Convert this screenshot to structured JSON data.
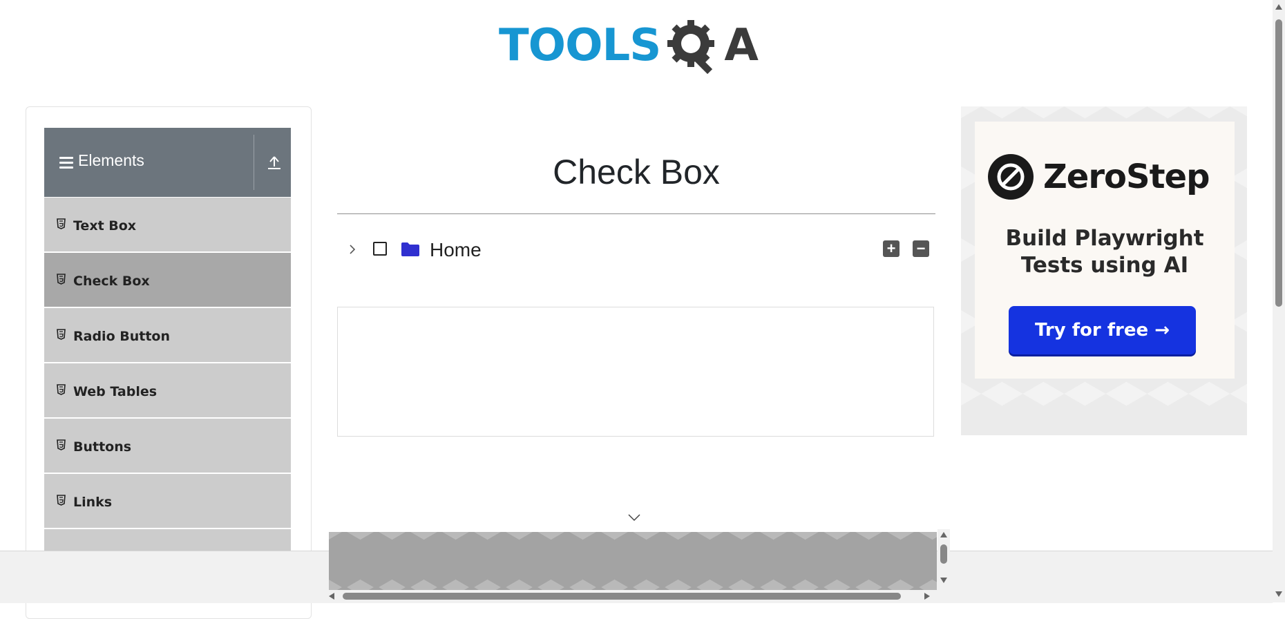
{
  "header": {
    "logo_text": "TOOLS",
    "logo_suffix": "A",
    "logo_alt": "TOOLSQA"
  },
  "sidebar": {
    "group_title": "Elements",
    "items": [
      {
        "label": "Text Box",
        "active": false
      },
      {
        "label": "Check Box",
        "active": true
      },
      {
        "label": "Radio Button",
        "active": false
      },
      {
        "label": "Web Tables",
        "active": false
      },
      {
        "label": "Buttons",
        "active": false
      },
      {
        "label": "Links",
        "active": false
      }
    ]
  },
  "main": {
    "title": "Check Box",
    "tree": {
      "root_label": "Home",
      "expand_all_symbol": "+",
      "collapse_all_symbol": "−"
    }
  },
  "ad": {
    "brand": "ZeroStep",
    "headline_line1": "Build Playwright",
    "headline_line2": "Tests using AI",
    "cta": "Try for free →"
  },
  "colors": {
    "brand_blue": "#1796d2",
    "sidebar_header": "#6c757d",
    "menu_item": "#cccccc",
    "menu_item_active": "#a8a8a8",
    "folder_icon": "#3030d0",
    "cta_blue": "#1533e0"
  },
  "icons": {
    "menu": "hamburger-icon",
    "group_toggle": "upload-arrow-icon",
    "menu_item": "html5-icon",
    "tree_toggle": "chevron-right-icon",
    "tree_folder": "folder-icon"
  }
}
